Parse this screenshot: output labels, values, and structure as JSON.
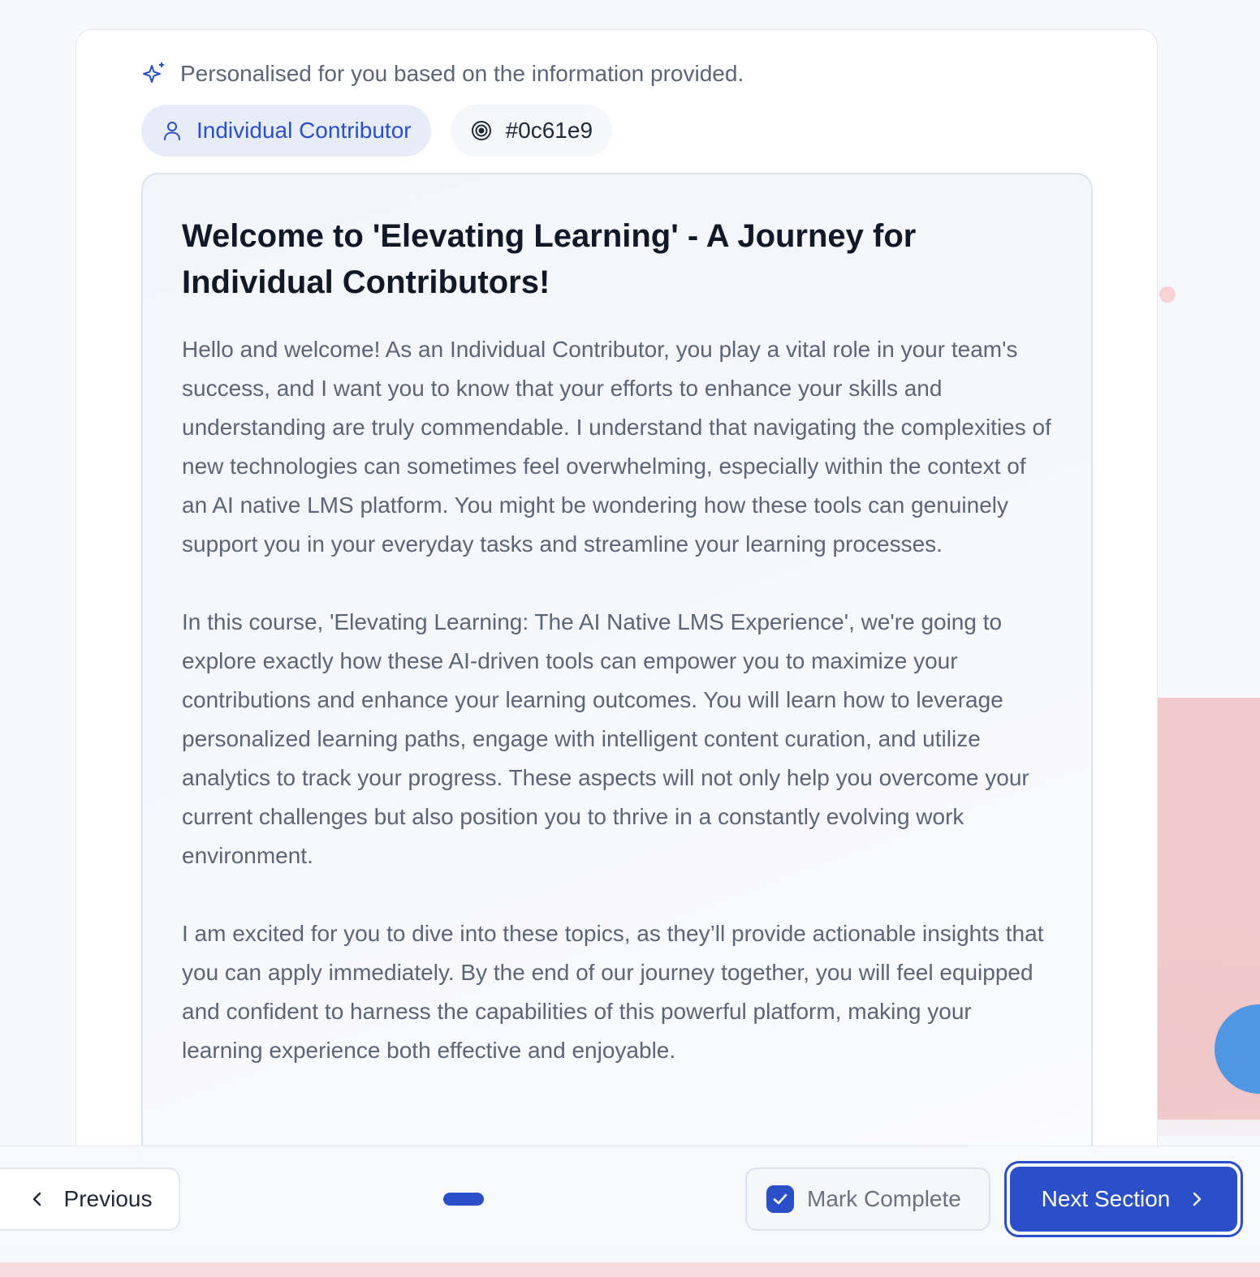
{
  "header": {
    "personalised_text": "Personalised for you based on the information provided.",
    "role_chip": "Individual Contributor",
    "code_chip": "#0c61e9"
  },
  "content": {
    "title": "Welcome to 'Elevating Learning' - A Journey for Individual Contributors!",
    "paragraphs": [
      "Hello and welcome! As an Individual Contributor, you play a vital role in your team's success, and I want you to know that your efforts to enhance your skills and understanding are truly commendable. I understand that navigating the complexities of new technologies can sometimes feel overwhelming, especially within the context of an AI native LMS platform. You might be wondering how these tools can genuinely support you in your everyday tasks and streamline your learning processes.",
      "In this course, 'Elevating Learning: The AI Native LMS Experience', we're going to explore exactly how these AI-driven tools can empower you to maximize your contributions and enhance your learning outcomes. You will learn how to leverage personalized learning paths, engage with intelligent content curation, and utilize analytics to track your progress. These aspects will not only help you overcome your current challenges but also position you to thrive in a constantly evolving work environment.",
      "I am excited for you to dive into these topics, as they’ll provide actionable insights that you can apply immediately. By the end of our journey together, you will feel equipped and confident to harness the capabilities of this powerful platform, making your learning experience both effective and enjoyable."
    ]
  },
  "footer": {
    "previous_label": "Previous",
    "mark_complete_label": "Mark Complete",
    "next_label": "Next Section"
  },
  "colors": {
    "accent": "#2a4fc9",
    "chip_bg": "#e7edf8",
    "text_muted": "#5b6577",
    "decor_pink": "#f0c4c7",
    "decor_blue": "#4f97e3"
  },
  "icons": [
    "sparkle-icon",
    "user-icon",
    "target-icon",
    "chevron-left-icon",
    "checkbox-checked-icon",
    "chevron-right-icon"
  ]
}
